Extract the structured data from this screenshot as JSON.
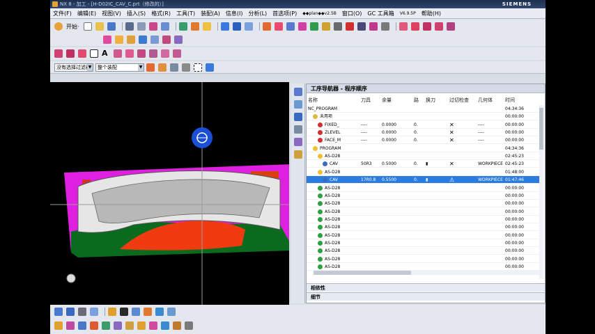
{
  "title": "NX 8 - 加工 - [H-D02IC_CAV_C.prt（修改的）]",
  "brand": "SIEMENS",
  "menu": [
    "文件(F)",
    "编辑(E)",
    "视图(V)",
    "插入(S)",
    "格式(R)",
    "工具(T)",
    "装配(A)",
    "信息(I)",
    "分析(L)",
    "首选项(P)",
    "窗口(O)",
    "GC 工具箱",
    "帮助(H)"
  ],
  "menu_extras": {
    "macro": "◆◆plan◆◆v2.5B",
    "version": "V6.9.5P"
  },
  "toolbar": {
    "start_label": "开始·"
  },
  "filter": {
    "type_value": "没有选择过滤器",
    "scope_value": "整个装配"
  },
  "colors": {
    "magenta": "#e020e0",
    "green": "#0a6b1e",
    "blue": "#1a4fd6",
    "highlight": "#2c7ce0"
  },
  "navigator": {
    "title": "工序导航器 - 程序顺序",
    "columns": [
      "名称",
      "刀具",
      "余量",
      "路",
      "换刀",
      "过切检查",
      "几何体",
      "时间"
    ],
    "rows": [
      {
        "name": "NC_PROGRAM",
        "tool": "",
        "stock": "",
        "path": "",
        "tc": "",
        "gouge": "",
        "geom": "",
        "time": "04:34:36",
        "indent": 0,
        "status": ""
      },
      {
        "name": "未用项",
        "tool": "",
        "stock": "",
        "path": "",
        "tc": "",
        "gouge": "",
        "geom": "",
        "time": "00:00:00",
        "indent": 1,
        "status": "folder"
      },
      {
        "name": "FIXED_",
        "tool": "----",
        "stock": "0.0000",
        "path": "0.",
        "tc": "",
        "gouge": "✕",
        "geom": "----",
        "time": "00:00:00",
        "indent": 2,
        "status": "block"
      },
      {
        "name": "ZLEVEL",
        "tool": "----",
        "stock": "0.0000",
        "path": "0.",
        "tc": "",
        "gouge": "✕",
        "geom": "----",
        "time": "00:00:00",
        "indent": 2,
        "status": "block"
      },
      {
        "name": "FACE_M",
        "tool": "----",
        "stock": "0.0000",
        "path": "0.",
        "tc": "",
        "gouge": "✕",
        "geom": "----",
        "time": "00:00:00",
        "indent": 2,
        "status": "block"
      },
      {
        "name": "PROGRAM",
        "tool": "",
        "stock": "",
        "path": "",
        "tc": "",
        "gouge": "",
        "geom": "",
        "time": "04:34:36",
        "indent": 1,
        "status": "prog"
      },
      {
        "name": "AS-D28",
        "tool": "",
        "stock": "",
        "path": "",
        "tc": "",
        "gouge": "",
        "geom": "",
        "time": "02:45:23",
        "indent": 2,
        "status": "prog"
      },
      {
        "name": "CAV",
        "tool": "50R3",
        "stock": "0.5000",
        "path": "0.",
        "tc": "▮",
        "gouge": "✕",
        "geom": "WORKPIECE",
        "time": "02:45:23",
        "indent": 3,
        "status": "op"
      },
      {
        "name": "AS-D28",
        "tool": "",
        "stock": "",
        "path": "",
        "tc": "",
        "gouge": "",
        "geom": "",
        "time": "01:48:00",
        "indent": 2,
        "status": "prog"
      },
      {
        "name": "CAV",
        "tool": "17R0.8",
        "stock": "0.5500",
        "path": "0.",
        "tc": "▮",
        "gouge": "⚠",
        "geom": "WORKPIECE",
        "time": "01:47:46",
        "indent": 3,
        "status": "op",
        "selected": true
      },
      {
        "name": "AS-D28",
        "tool": "",
        "stock": "",
        "path": "",
        "tc": "",
        "gouge": "",
        "geom": "",
        "time": "00:00:00",
        "indent": 2,
        "status": "ok"
      },
      {
        "name": "AS-D28",
        "tool": "",
        "stock": "",
        "path": "",
        "tc": "",
        "gouge": "",
        "geom": "",
        "time": "00:00:00",
        "indent": 2,
        "status": "ok"
      },
      {
        "name": "AS-D28",
        "tool": "",
        "stock": "",
        "path": "",
        "tc": "",
        "gouge": "",
        "geom": "",
        "time": "00:00:00",
        "indent": 2,
        "status": "ok"
      },
      {
        "name": "AS-D28",
        "tool": "",
        "stock": "",
        "path": "",
        "tc": "",
        "gouge": "",
        "geom": "",
        "time": "00:00:00",
        "indent": 2,
        "status": "ok"
      },
      {
        "name": "AS-D28",
        "tool": "",
        "stock": "",
        "path": "",
        "tc": "",
        "gouge": "",
        "geom": "",
        "time": "00:00:00",
        "indent": 2,
        "status": "ok"
      },
      {
        "name": "AS-D28",
        "tool": "",
        "stock": "",
        "path": "",
        "tc": "",
        "gouge": "",
        "geom": "",
        "time": "00:00:00",
        "indent": 2,
        "status": "ok"
      },
      {
        "name": "AS-D28",
        "tool": "",
        "stock": "",
        "path": "",
        "tc": "",
        "gouge": "",
        "geom": "",
        "time": "00:00:00",
        "indent": 2,
        "status": "ok"
      },
      {
        "name": "AS-D28",
        "tool": "",
        "stock": "",
        "path": "",
        "tc": "",
        "gouge": "",
        "geom": "",
        "time": "00:00:00",
        "indent": 2,
        "status": "ok"
      },
      {
        "name": "AS-D28",
        "tool": "",
        "stock": "",
        "path": "",
        "tc": "",
        "gouge": "",
        "geom": "",
        "time": "00:00:00",
        "indent": 2,
        "status": "ok"
      },
      {
        "name": "AS-D28",
        "tool": "",
        "stock": "",
        "path": "",
        "tc": "",
        "gouge": "",
        "geom": "",
        "time": "00:00:00",
        "indent": 2,
        "status": "ok"
      },
      {
        "name": "AS-D28",
        "tool": "",
        "stock": "",
        "path": "",
        "tc": "",
        "gouge": "",
        "geom": "",
        "time": "00:00:00",
        "indent": 2,
        "status": "ok"
      }
    ],
    "sections": [
      "相依性",
      "细节"
    ]
  }
}
